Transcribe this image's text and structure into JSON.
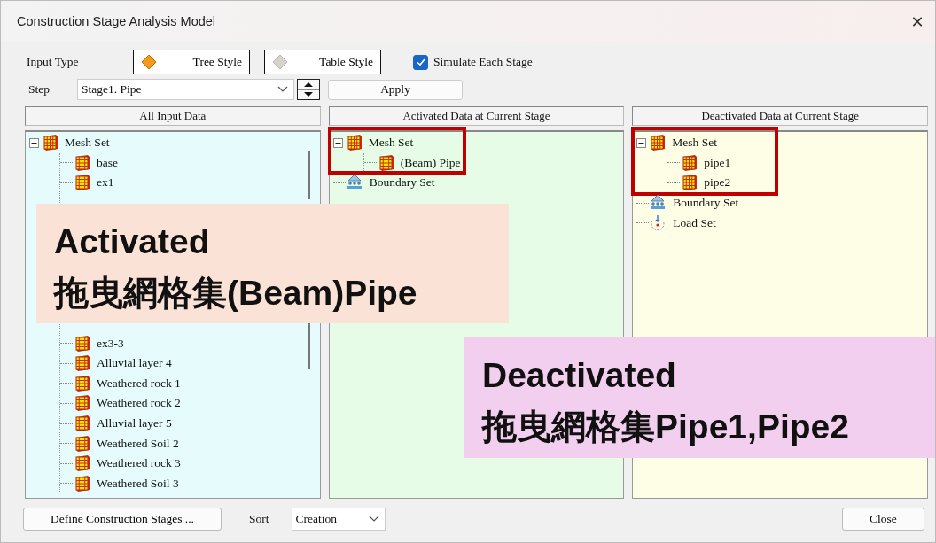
{
  "window": {
    "title": "Construction Stage Analysis Model",
    "close": "✕"
  },
  "input_type": {
    "label": "Input Type",
    "options": [
      {
        "label": "Tree Style",
        "selected": true
      },
      {
        "label": "Table Style",
        "selected": false
      }
    ]
  },
  "simulate_each_stage": {
    "label": "Simulate Each Stage",
    "checked": true
  },
  "step": {
    "label": "Step",
    "value": "Stage1. Pipe"
  },
  "apply_button": "Apply",
  "panels": [
    {
      "header": "All Input Data",
      "color": "#e6fcfc",
      "tree": [
        {
          "label": "Mesh Set",
          "kind": "mesh",
          "expanded": true,
          "highlighted": false,
          "children": [
            {
              "label": "base",
              "kind": "mesh"
            },
            {
              "label": "ex1",
              "kind": "mesh"
            },
            {
              "label": "ex3-3",
              "kind": "mesh"
            },
            {
              "label": "Alluvial layer 4",
              "kind": "mesh"
            },
            {
              "label": "Weathered rock 1",
              "kind": "mesh"
            },
            {
              "label": "Weathered rock 2",
              "kind": "mesh"
            },
            {
              "label": "Alluvial layer 5",
              "kind": "mesh"
            },
            {
              "label": "Weathered Soil 2",
              "kind": "mesh"
            },
            {
              "label": "Weathered rock 3",
              "kind": "mesh"
            },
            {
              "label": "Weathered Soil 3",
              "kind": "mesh"
            }
          ]
        }
      ]
    },
    {
      "header": "Activated Data at Current Stage",
      "color": "#e6fce6",
      "tree": [
        {
          "label": "Mesh Set",
          "kind": "mesh",
          "expanded": true,
          "highlighted": true,
          "children": [
            {
              "label": "(Beam) Pipe",
              "kind": "mesh"
            }
          ]
        },
        {
          "label": "Boundary Set",
          "kind": "boundary"
        }
      ]
    },
    {
      "header": "Deactivated Data at Current Stage",
      "color": "#fefee6",
      "tree": [
        {
          "label": "Mesh Set",
          "kind": "mesh",
          "expanded": true,
          "highlighted": true,
          "children": [
            {
              "label": "pipe1",
              "kind": "mesh"
            },
            {
              "label": "pipe2",
              "kind": "mesh"
            }
          ]
        },
        {
          "label": "Boundary Set",
          "kind": "boundary"
        },
        {
          "label": "Load Set",
          "kind": "load"
        }
      ]
    }
  ],
  "callouts": [
    {
      "lines": [
        "Activated",
        "拖曳網格集(Beam)Pipe"
      ],
      "color": "#fbe2d6"
    },
    {
      "lines": [
        "Deactivated",
        "拖曳網格集Pipe1,Pipe2"
      ],
      "color": "#f2cfee"
    }
  ],
  "footer": {
    "define_button": "Define Construction Stages ...",
    "sort_label": "Sort",
    "sort_value": "Creation",
    "close_button": "Close"
  }
}
